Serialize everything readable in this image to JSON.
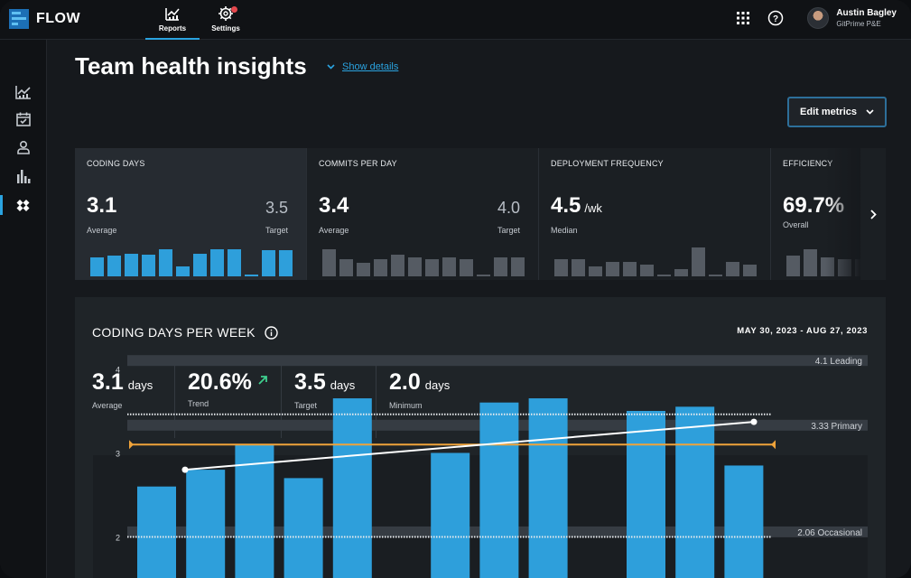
{
  "app": {
    "name": "FLOW"
  },
  "nav": {
    "tabs": [
      {
        "label": "Reports",
        "icon": "reports-chart-icon",
        "active": true
      },
      {
        "label": "Settings",
        "icon": "settings-gear-icon",
        "active": false
      }
    ]
  },
  "user": {
    "name": "Austin Bagley",
    "org": "GitPrime P&E"
  },
  "sidebar": {
    "items": [
      {
        "icon": "line-chart-icon",
        "active": false
      },
      {
        "icon": "calendar-check-icon",
        "active": false
      },
      {
        "icon": "person-icon",
        "active": false
      },
      {
        "icon": "bar-chart-icon",
        "active": false
      },
      {
        "icon": "diamonds-icon",
        "active": true
      }
    ]
  },
  "header": {
    "title": "Team health insights",
    "show_details": "Show details",
    "edit_metrics": "Edit metrics"
  },
  "cards": [
    {
      "title": "CODING DAYS",
      "value": "3.1",
      "sub": "Average",
      "target": "3.5",
      "target_sub": "Target",
      "spark": [
        0.55,
        0.6,
        0.65,
        0.62,
        0.78,
        0.3,
        0.65,
        0.78,
        0.78,
        0.05,
        0.75,
        0.75
      ],
      "color": "#2e9fdb",
      "active": true
    },
    {
      "title": "COMMITS PER DAY",
      "value": "3.4",
      "sub": "Average",
      "target": "4.0",
      "target_sub": "Target",
      "spark": [
        0.78,
        0.5,
        0.4,
        0.5,
        0.62,
        0.55,
        0.5,
        0.55,
        0.5,
        0.05,
        0.55,
        0.55
      ],
      "color": "#555b63",
      "active": false
    },
    {
      "title": "DEPLOYMENT FREQUENCY",
      "value": "4.5",
      "unit": "/wk",
      "sub": "Median",
      "spark": [
        0.5,
        0.5,
        0.3,
        0.42,
        0.42,
        0.35,
        0.05,
        0.2,
        0.85,
        0.05,
        0.42,
        0.35
      ],
      "color": "#555b63",
      "active": false
    },
    {
      "title": "EFFICIENCY",
      "value": "69.7%",
      "sub": "Overall",
      "spark": [
        0.6,
        0.8,
        0.55,
        0.5,
        0.5
      ],
      "color": "#555b63",
      "active": false
    }
  ],
  "panel": {
    "title": "CODING DAYS PER WEEK",
    "date_range": "MAY 30, 2023 - AUG 27, 2023",
    "stats": [
      {
        "value": "3.1",
        "unit": "days",
        "label": "Average"
      },
      {
        "value": "20.6%",
        "unit": "",
        "label": "Trend",
        "trend_icon": "arrow-up-right-icon"
      },
      {
        "value": "3.5",
        "unit": "days",
        "label": "Target"
      },
      {
        "value": "2.0",
        "unit": "days",
        "label": "Minimum"
      }
    ]
  },
  "chart_data": {
    "type": "bar",
    "yticks": [
      "4",
      "3",
      "2"
    ],
    "ylim": [
      1.5,
      4.3
    ],
    "values": [
      2.6,
      2.8,
      3.1,
      2.7,
      3.65,
      null,
      3.0,
      3.6,
      3.65,
      null,
      3.5,
      3.55,
      2.85
    ],
    "bands": [
      {
        "label": "4.1 Leading",
        "value": 4.1
      },
      {
        "label": "3.33 Primary",
        "value": 3.33
      },
      {
        "label": "2.06 Occasional",
        "value": 2.06
      }
    ],
    "target": 3.1,
    "trend": {
      "start": 2.8,
      "end": 3.37
    },
    "reference_dotted": [
      3.46,
      2.0
    ],
    "colors": {
      "bar": "#2e9fdb",
      "target": "#f0a33a",
      "trend": "#ffffff",
      "band": "#363c43"
    }
  }
}
